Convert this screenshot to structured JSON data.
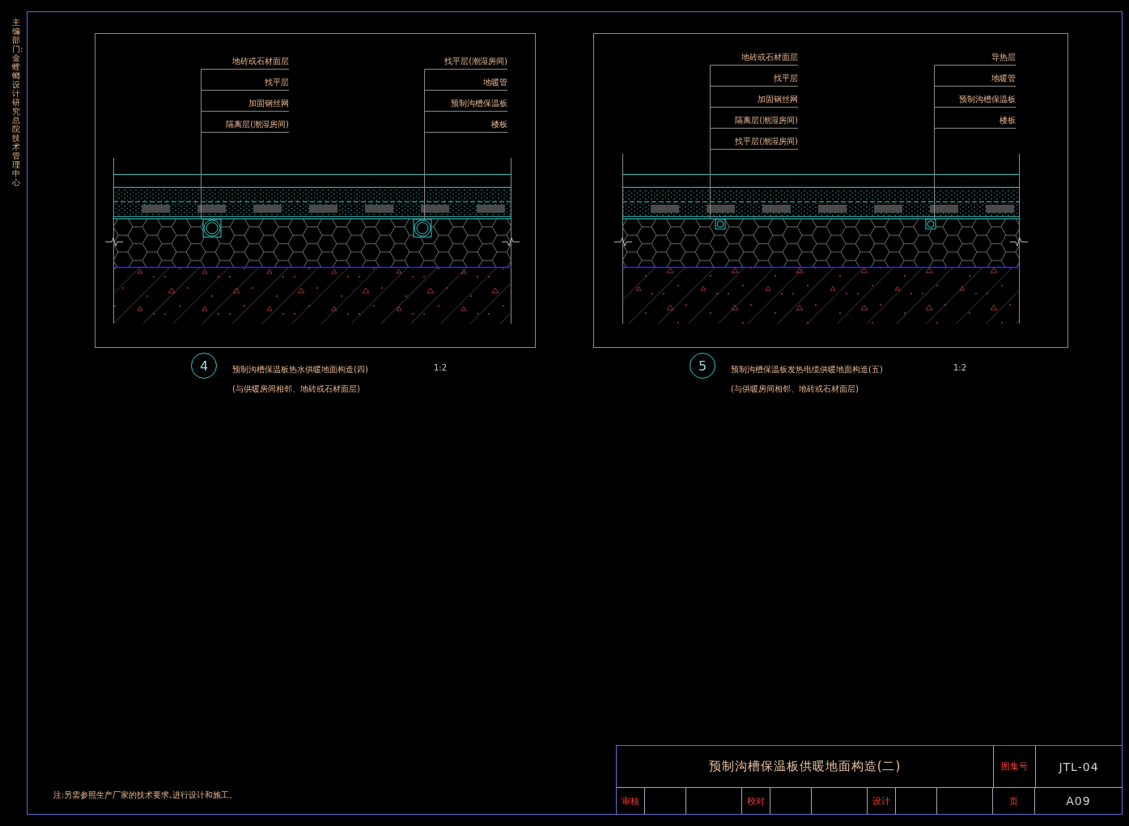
{
  "side_note": "主编部门:金螳螂设计研究总院技术管理中心",
  "details": [
    {
      "number": "4",
      "kind": "pipe",
      "left_labels": [
        "地砖或石材面层",
        "找平层",
        "加固钢丝网",
        "隔离层(潮湿房间)"
      ],
      "right_labels": [
        "找平层(潮湿房间)",
        "地暖管",
        "预制沟槽保温板",
        "楼板"
      ],
      "caption": "预制沟槽保温板热水供暖地面构造(四)",
      "subcaption": "(与供暖房间相邻、地砖或石材面层)",
      "scale": "1:2"
    },
    {
      "number": "5",
      "kind": "cable",
      "left_labels": [
        "地砖或石材面层",
        "找平层",
        "加固钢丝网",
        "隔离层(潮湿房间)",
        "找平层(潮湿房间)"
      ],
      "right_labels": [
        "导热层",
        "地暖管",
        "预制沟槽保温板",
        "楼板"
      ],
      "caption": "预制沟槽保温板发热电缆供暖地面构造(五)",
      "subcaption": "(与供暖房间相邻、地砖或石材面层)",
      "scale": "1:2"
    }
  ],
  "note": "注:另需参照生产厂家的技术要求,进行设计和施工。",
  "title_block": {
    "title": "预制沟槽保温板供暖地面构造(二)",
    "atlas_label": "图集号",
    "atlas_number": "JTL-04",
    "signoffs": [
      {
        "label": "审核"
      },
      {
        "label": "校对"
      },
      {
        "label": "设计"
      }
    ],
    "page_label": "页",
    "page_number": "A09"
  }
}
